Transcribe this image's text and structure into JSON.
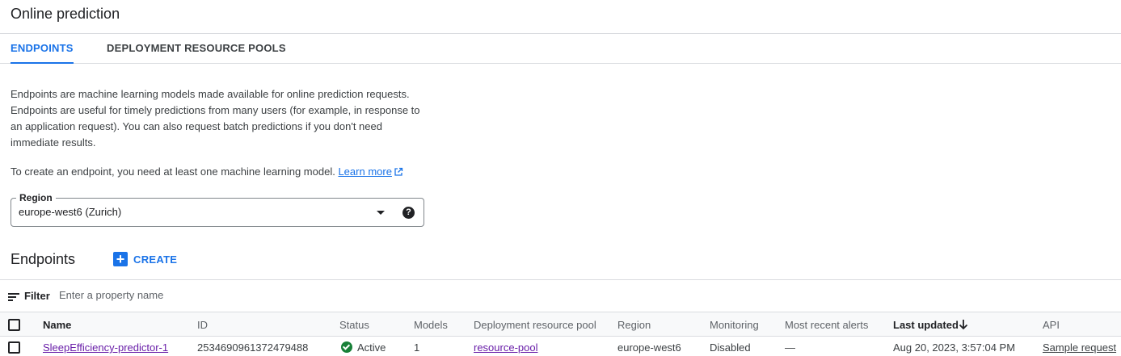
{
  "page": {
    "title": "Online prediction"
  },
  "tabs": [
    {
      "label": "ENDPOINTS",
      "active": true
    },
    {
      "label": "DEPLOYMENT RESOURCE POOLS",
      "active": false
    }
  ],
  "description": {
    "paragraph": "Endpoints are machine learning models made available for online prediction requests. Endpoints are useful for timely predictions from many users (for example, in response to an application request). You can also request batch predictions if you don't need immediate results.",
    "prereq_text": "To create an endpoint, you need at least one machine learning model.",
    "learn_more": "Learn more"
  },
  "region": {
    "label": "Region",
    "value": "europe-west6 (Zurich)"
  },
  "endpoints": {
    "title": "Endpoints",
    "create_label": "CREATE"
  },
  "filter": {
    "label": "Filter",
    "placeholder": "Enter a property name"
  },
  "table": {
    "columns": {
      "name": "Name",
      "id": "ID",
      "status": "Status",
      "models": "Models",
      "pool": "Deployment resource pool",
      "region": "Region",
      "monitoring": "Monitoring",
      "alerts": "Most recent alerts",
      "updated": "Last updated",
      "api": "API"
    },
    "rows": [
      {
        "name": "SleepEfficiency-predictor-1",
        "id": "2534690961372479488",
        "status": "Active",
        "models": "1",
        "pool": "resource-pool",
        "region": "europe-west6",
        "monitoring": "Disabled",
        "alerts": "—",
        "updated": "Aug 20, 2023, 3:57:04 PM",
        "api": "Sample request"
      }
    ]
  },
  "colors": {
    "accent": "#1a73e8",
    "status_active": "#188038",
    "visited_link": "#681da8"
  },
  "icons": [
    "external-link-icon",
    "dropdown-arrow-icon",
    "help-icon",
    "plus-icon",
    "filter-icon",
    "sort-down-arrow-icon",
    "check-circle-icon"
  ]
}
